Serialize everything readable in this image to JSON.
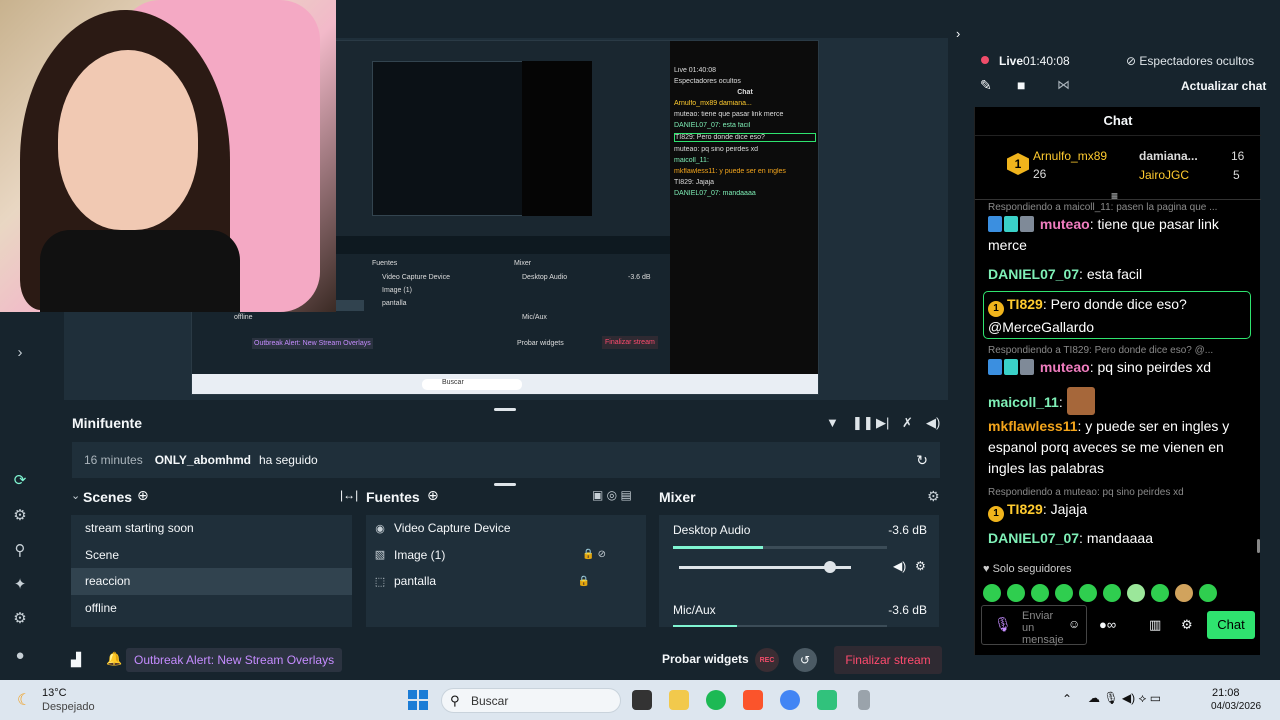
{
  "preview": {
    "nested_chat_lines": [
      "Live 01:40:08",
      "Espectadores ocultos",
      "Chat",
      "Arnulfo_mx89  damiana...",
      "muteao: tiene que pasar link merce",
      "DANIEL07_07: esta facil",
      "TI829: Pero donde dice eso?",
      "muteao: pq sino peirdes xd",
      "maicoll_11:",
      "mkflawless11: y puede ser en ingles",
      "TI829: Jajaja",
      "DANIEL07_07: mandaaaa"
    ],
    "nested_panel_labels": [
      "Fuentes",
      "Mixer",
      "Video Capture Device",
      "Image (1)",
      "pantalla",
      "Desktop Audio",
      "Mic/Aux",
      "reaccion",
      "offline",
      "Outbreak Alert: New Stream Overlays",
      "Probar widgets",
      "Finalizar stream",
      "Buscar"
    ],
    "nested_db": "-3.6 dB"
  },
  "minifuente": {
    "title": "Minifuente",
    "event_time": "16 minutes",
    "event_user": "ONLY_abomhmd",
    "event_text": "ha seguido"
  },
  "scenes": {
    "title": "Scenes",
    "items": [
      "stream starting soon",
      "Scene",
      "reaccion",
      "offline"
    ],
    "selected": "reaccion"
  },
  "fuentes": {
    "title": "Fuentes",
    "items": [
      "Video Capture Device",
      "Image (1)",
      "pantalla"
    ]
  },
  "mixer": {
    "title": "Mixer",
    "channels": [
      {
        "name": "Desktop Audio",
        "db": "-3.6 dB",
        "level": 0.42,
        "volume": 0.88
      },
      {
        "name": "Mic/Aux",
        "db": "-3.6 dB",
        "level": 0.3,
        "volume": 0.88
      }
    ]
  },
  "bottom": {
    "alert": "Outbreak Alert: New Stream Overlays",
    "probar": "Probar widgets",
    "rec": "REC",
    "finalizar": "Finalizar stream"
  },
  "right": {
    "live": "Live",
    "live_time": "01:40:08",
    "viewers": "Espectadores ocultos",
    "update_chat": "Actualizar chat",
    "chat_title": "Chat",
    "leaderboard": {
      "first_user": "Arnulfo_mx89",
      "first_count": "26",
      "second_user": "damiana...",
      "second_count": "16",
      "third_user": "JairoJGC",
      "third_count": "5"
    },
    "messages": [
      {
        "reply": "Respondiendo a maicoll_11: pasen la pagina que ..."
      },
      {
        "user": "muteao",
        "text": ": tiene que pasar link merce"
      },
      {
        "user": "DANIEL07_07",
        "text": ": esta facil"
      },
      {
        "user": "TI829",
        "text": ": Pero donde dice eso? @MerceGallardo"
      },
      {
        "reply": "Respondiendo a TI829: Pero donde dice eso? @..."
      },
      {
        "user": "muteao",
        "text": ": pq sino peirdes xd"
      },
      {
        "user": "maicoll_11",
        "text": ":"
      },
      {
        "user": "mkflawless11",
        "text": ": y puede ser en ingles y espanol porq aveces se me vienen en ingles las palabras"
      },
      {
        "reply": "Respondiendo a muteao: pq sino peirdes xd"
      },
      {
        "user": "TI829",
        "text": ": Jajaja"
      },
      {
        "user": "DANIEL07_07",
        "text": ": mandaaaa"
      }
    ],
    "followers_only": "Solo seguidores",
    "input_placeholder": "Enviar un mensaje",
    "chat_button": "Chat"
  },
  "taskbar": {
    "temp": "13°C",
    "weather": "Despejado",
    "search": "Buscar",
    "time": "21:08",
    "date": "04/03/2026"
  },
  "colors": {
    "accent_green": "#2fe36f",
    "live_red": "#f04d6a",
    "alert_purple": "#c58cff"
  }
}
